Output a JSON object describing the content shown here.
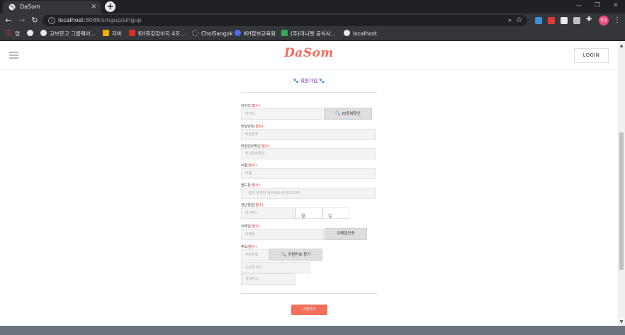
{
  "browser": {
    "tab_title": "DaSom",
    "tab_close": "✕",
    "new_tab": "+",
    "url_host": "localhost",
    "url_rest": ":8088/singup/singup",
    "bookmarks": [
      {
        "label": "앱"
      },
      {
        "label": ""
      },
      {
        "label": "교보문고 그룹웨어..."
      },
      {
        "label": "자바"
      },
      {
        "label": "KH최강강아지 4조..."
      },
      {
        "label": "ChoiSangok"
      },
      {
        "label": "KH정보교육원"
      },
      {
        "label": "(주)미니펫 공식사..."
      },
      {
        "label": "localhost"
      }
    ],
    "profile_label": "방문",
    "colors": {
      "frame": "#202124",
      "toolbar": "#35363a",
      "profile": "#e94b7d"
    }
  },
  "header": {
    "logo": "DaSom",
    "login": "LOGIN"
  },
  "form": {
    "title": "🐾 회원가입 🐾",
    "id": {
      "label": "아이디",
      "req": "(필수)",
      "placeholder": "아이디",
      "check_button": "ID중복확인"
    },
    "password": {
      "label": "비밀번호",
      "req": "(필수)",
      "placeholder": "비밀번호"
    },
    "password_confirm": {
      "label": "비밀번호확인",
      "req": "(필수)",
      "placeholder": "비밀번호확인"
    },
    "name": {
      "label": "이름",
      "req": "(필수)",
      "placeholder": "이름"
    },
    "phone": {
      "label": "핸드폰",
      "req": "(필수)",
      "placeholder": "-없이 숫자만 써주세요(숫자11자리)"
    },
    "birth": {
      "label": "생년월일",
      "req": "(필수)",
      "year_placeholder": "년(4자)",
      "month_unit": "월",
      "day_unit": "일"
    },
    "email": {
      "label": "이메일",
      "req": "(필수)",
      "placeholder": "이메일",
      "verify_button": "이메일인증"
    },
    "address": {
      "label": "주소",
      "req": "(필수)",
      "zip_placeholder": "우편번호",
      "zip_button": "우편번호 찾기",
      "road_placeholder": "도로명 주소",
      "detail_placeholder": "상세주소"
    },
    "submit": "가입하기"
  },
  "colors": {
    "brand": "#f26b5b",
    "required": "#e53935",
    "title": "#7b1fa2"
  }
}
